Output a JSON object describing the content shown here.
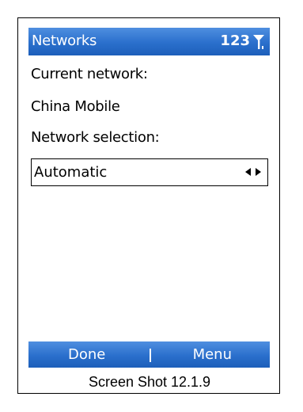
{
  "header": {
    "title": "Networks",
    "status_text": "123"
  },
  "content": {
    "current_network_label": "Current network:",
    "current_network_value": "China Mobile",
    "selection_label": "Network selection:",
    "selection_value": "Automatic"
  },
  "softkeys": {
    "left": "Done",
    "right": "Menu"
  },
  "caption": "Screen Shot 12.1.9",
  "colors": {
    "bar": "#2a6fcc",
    "text": "#000000"
  },
  "icons": {
    "signal": "signal-strength-icon",
    "left_arrow": "arrow-left-icon",
    "right_arrow": "arrow-right-icon"
  }
}
